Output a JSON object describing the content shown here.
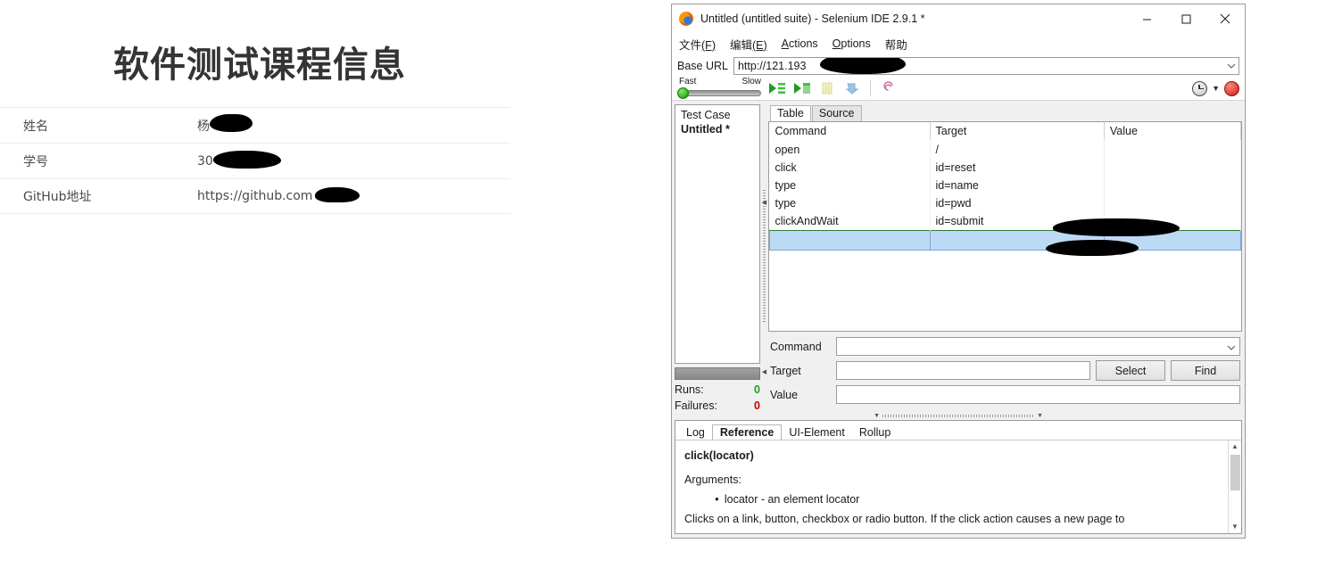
{
  "course_page": {
    "title": "软件测试课程信息",
    "rows": [
      {
        "label": "姓名",
        "value": "杨"
      },
      {
        "label": "学号",
        "value": "30"
      },
      {
        "label": "GitHub地址",
        "value": "https://github.com"
      }
    ]
  },
  "selenium": {
    "titlebar": {
      "title": "Untitled (untitled suite) - Selenium IDE 2.9.1 *",
      "icon": "firefox-icon",
      "minimize": "−",
      "maximize": "□",
      "close": "✕"
    },
    "menu": [
      {
        "label": "文件(F)"
      },
      {
        "label": "编辑(E)"
      },
      {
        "label": "Actions"
      },
      {
        "label": "Options"
      },
      {
        "label": "帮助"
      }
    ],
    "baseurl": {
      "label": "Base URL",
      "value": "http://121.193",
      "dropdown_icon": "chevron-down-icon"
    },
    "toolbar": {
      "speed_fast": "Fast",
      "speed_slow": "Slow",
      "buttons": [
        "play-all-icon",
        "play-current-icon",
        "pause-icon",
        "step-icon",
        "rollup-icon"
      ],
      "clock_icon": "clock-icon",
      "dropdown_icon": "caret-down-icon",
      "record_icon": "record-icon"
    },
    "testcase_panel": {
      "header": "Test Case",
      "item": "Untitled *",
      "runs_label": "Runs:",
      "runs_value": "0",
      "failures_label": "Failures:",
      "failures_value": "0",
      "runs_color": "#1ca01c",
      "failures_color": "#d00000"
    },
    "tabs": [
      {
        "label": "Table",
        "active": true
      },
      {
        "label": "Source",
        "active": false
      }
    ],
    "command_table": {
      "headers": [
        "Command",
        "Target",
        "Value"
      ],
      "rows": [
        {
          "command": "open",
          "target": "/",
          "value": ""
        },
        {
          "command": "click",
          "target": "id=reset",
          "value": ""
        },
        {
          "command": "type",
          "target": "id=name",
          "value": ""
        },
        {
          "command": "type",
          "target": "id=pwd",
          "value": ""
        },
        {
          "command": "clickAndWait",
          "target": "id=submit",
          "value": ""
        }
      ],
      "selected_row_color": "#bcd9f5"
    },
    "editor": {
      "command_label": "Command",
      "command_value": "",
      "target_label": "Target",
      "target_value": "",
      "value_label": "Value",
      "value_value": "",
      "select_button": "Select",
      "find_button": "Find"
    },
    "bottom_panel": {
      "tabs": [
        {
          "label": "Log",
          "active": false
        },
        {
          "label": "Reference",
          "active": true
        },
        {
          "label": "UI-Element",
          "active": false
        },
        {
          "label": "Rollup",
          "active": false
        }
      ],
      "signature": "click(locator)",
      "arguments_label": "Arguments:",
      "argument_item": "locator - an element locator",
      "description": "Clicks on a link, button, checkbox or radio button. If the click action causes a new page to"
    }
  }
}
